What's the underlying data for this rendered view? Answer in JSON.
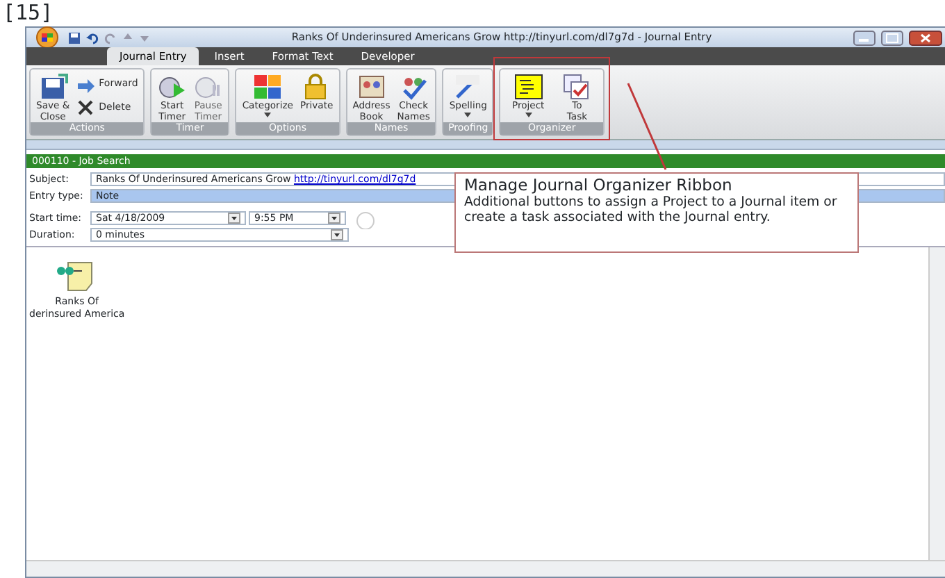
{
  "page_label": "[15]",
  "window": {
    "title": "Ranks Of Underinsured Americans Grow http://tinyurl.com/dl7g7d - Journal Entry"
  },
  "ribbon_tabs": [
    {
      "label": "Journal Entry",
      "selected": true
    },
    {
      "label": "Insert",
      "selected": false
    },
    {
      "label": "Format Text",
      "selected": false
    },
    {
      "label": "Developer",
      "selected": false
    }
  ],
  "ribbon_groups": [
    {
      "name": "Actions",
      "buttons": [
        {
          "kind": "large",
          "label": "Save &\nClose",
          "disabled": false
        },
        {
          "kind": "small",
          "label": "Forward",
          "disabled": false
        },
        {
          "kind": "small",
          "label": "Delete",
          "disabled": false
        }
      ]
    },
    {
      "name": "Timer",
      "buttons": [
        {
          "kind": "large",
          "label": "Start\nTimer",
          "disabled": false
        },
        {
          "kind": "large",
          "label": "Pause\nTimer",
          "disabled": true
        }
      ]
    },
    {
      "name": "Options",
      "buttons": [
        {
          "kind": "dropdown",
          "label": "Categorize",
          "disabled": false
        },
        {
          "kind": "large",
          "label": "Private",
          "disabled": false
        }
      ]
    },
    {
      "name": "Names",
      "buttons": [
        {
          "kind": "large",
          "label": "Address\nBook",
          "disabled": false
        },
        {
          "kind": "large",
          "label": "Check\nNames",
          "disabled": false
        }
      ]
    },
    {
      "name": "Proofing",
      "buttons": [
        {
          "kind": "dropdown",
          "label": "Spelling",
          "disabled": false
        }
      ]
    },
    {
      "name": "Organizer",
      "buttons": [
        {
          "kind": "dropdown",
          "label": "Project",
          "disabled": false
        },
        {
          "kind": "large",
          "label": "To\nTask",
          "disabled": false
        }
      ]
    }
  ],
  "infobar": "000110 - Job Search",
  "subject": {
    "label": "Subject:",
    "value": "Ranks Of Underinsured Americans Grow",
    "link": "http://tinyurl.com/dl7g7d"
  },
  "entry_type": {
    "label": "Entry type:",
    "value": "Note"
  },
  "start_time": {
    "label": "Start time:",
    "date": "Sat 4/18/2009",
    "time": "9:55 PM"
  },
  "duration": {
    "label": "Duration:",
    "value": "0 minutes"
  },
  "attachment": {
    "label": "Ranks Of\nderinsured America"
  },
  "callout": {
    "title": "Manage Journal Organizer Ribbon",
    "text": "Additional buttons to assign a Project to a Journal item or create a task associated with the Journal entry."
  }
}
